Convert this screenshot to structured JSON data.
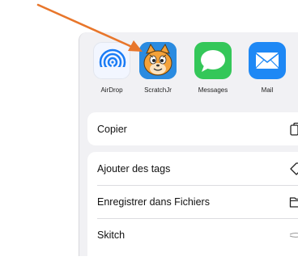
{
  "share_sheet": {
    "apps": [
      {
        "label": "AirDrop",
        "icon": "airdrop-icon"
      },
      {
        "label": "ScratchJr",
        "icon": "scratchjr-cat-icon"
      },
      {
        "label": "Messages",
        "icon": "messages-bubble-icon"
      },
      {
        "label": "Mail",
        "icon": "mail-envelope-icon"
      }
    ],
    "actions": [
      {
        "label": "Copier",
        "icon": "copy-icon"
      },
      {
        "label": "Ajouter des tags",
        "icon": "tag-icon"
      },
      {
        "label": "Enregistrer dans Fichiers",
        "icon": "folder-icon"
      },
      {
        "label": "Skitch",
        "icon": "skitch-icon"
      }
    ]
  },
  "annotation": {
    "arrow_color": "#e8762b",
    "icon": "arrow-annotation"
  },
  "colors": {
    "sheet_background": "#f1f1f4",
    "messages_green": "#34c759",
    "mail_blue": "#1e88f5",
    "airdrop_blue": "#1a7cf5",
    "scratch_bg": "#2a8be0",
    "cat_orange": "#f4a23a"
  }
}
